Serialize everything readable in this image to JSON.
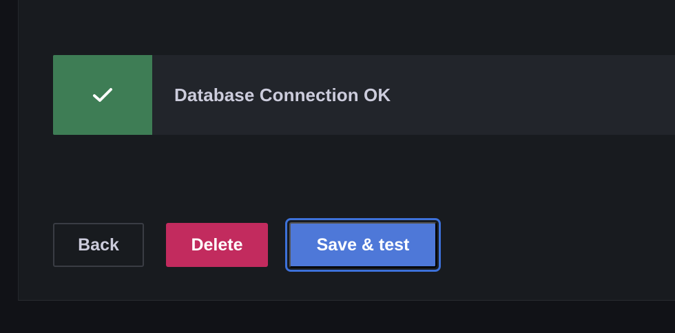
{
  "alert": {
    "status": "success",
    "icon": "check-icon",
    "title": "Database Connection OK",
    "color": "#3e7d55"
  },
  "actions": {
    "back_label": "Back",
    "delete_label": "Delete",
    "save_label": "Save & test"
  },
  "colors": {
    "delete": "#c22b5e",
    "primary": "#4e78d8",
    "focus_ring": "#3d71d9"
  }
}
